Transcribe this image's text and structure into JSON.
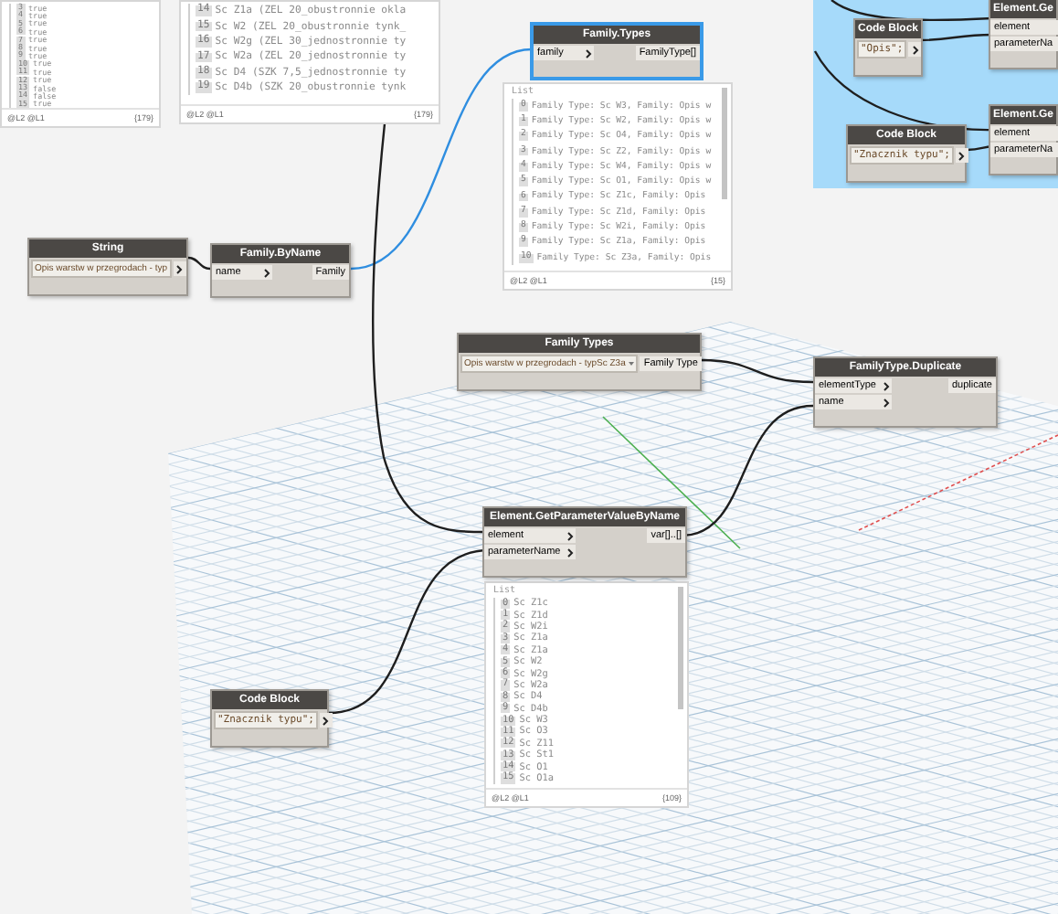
{
  "nodes": [
    {
      "kind": "string",
      "title": "String",
      "value": "Opis warstw w przegrodach - typ",
      "selected": false
    },
    {
      "kind": "function",
      "title": "Family.ByName",
      "inputs": [
        "name"
      ],
      "outputs": [
        "Family"
      ],
      "selected": false
    },
    {
      "kind": "function",
      "title": "Family.Types",
      "inputs": [
        "family"
      ],
      "outputs": [
        "FamilyType[]"
      ],
      "selected": true
    },
    {
      "kind": "dropdown",
      "title": "Family Types",
      "value": "Opis warstw w przegrodach - typSc Z3a",
      "outputs": [
        "Family Type"
      ],
      "selected": false
    },
    {
      "kind": "function",
      "title": "FamilyType.Duplicate",
      "inputs": [
        "elementType",
        "name"
      ],
      "outputs": [
        "duplicate"
      ],
      "selected": false
    },
    {
      "kind": "function",
      "title": "Element.GetParameterValueByName",
      "inputs": [
        "element",
        "parameterName"
      ],
      "outputs": [
        "var[]..[]"
      ],
      "selected": false
    },
    {
      "kind": "code",
      "title": "Code Block",
      "value": "\"Znacznik typu\";",
      "selected": false
    },
    {
      "kind": "code",
      "title": "Code Block",
      "value": "\"Opis\";",
      "selected": false
    },
    {
      "kind": "function",
      "title": "Element.Ge",
      "inputs": [
        "element",
        "parameterNa"
      ],
      "selected": false
    },
    {
      "kind": "code",
      "title": "Code Block",
      "value": "\"Znacznik typu\";",
      "selected": false
    },
    {
      "kind": "function",
      "title": "Element.Ge",
      "inputs": [
        "element",
        "parameterNa"
      ],
      "selected": false
    }
  ],
  "previews": [
    {
      "items": [
        {
          "index": "3",
          "value": "true"
        },
        {
          "index": "4",
          "value": "true"
        },
        {
          "index": "5",
          "value": "true"
        },
        {
          "index": "6",
          "value": "true"
        },
        {
          "index": "7",
          "value": "true"
        },
        {
          "index": "8",
          "value": "true"
        },
        {
          "index": "9",
          "value": "true"
        },
        {
          "index": "10",
          "value": "true"
        },
        {
          "index": "11",
          "value": "true"
        },
        {
          "index": "12",
          "value": "true"
        },
        {
          "index": "13",
          "value": "false"
        },
        {
          "index": "14",
          "value": "false"
        },
        {
          "index": "15",
          "value": "true"
        }
      ],
      "levels": "@L2 @L1",
      "count": "{179}"
    },
    {
      "items": [
        {
          "index": "14",
          "value": "Sc Z1a (ZEL 20_obustronnie okla"
        },
        {
          "index": "15",
          "value": "Sc W2 (ZEL 20_obustronnie tynk_"
        },
        {
          "index": "16",
          "value": "Sc W2g (ZEL 30_jednostronnie ty"
        },
        {
          "index": "17",
          "value": "Sc W2a (ZEL 20_jednostronnie ty"
        },
        {
          "index": "18",
          "value": "Sc D4 (SZK 7,5_jednostronnie ty"
        },
        {
          "index": "19",
          "value": "Sc D4b (SZK 20_obustronnie tynk"
        }
      ],
      "levels": "@L2 @L1",
      "count": "{179}"
    },
    {
      "header": "List",
      "items": [
        {
          "index": "0",
          "value": "Family Type: Sc W3, Family: Opis w"
        },
        {
          "index": "1",
          "value": "Family Type: Sc W2, Family: Opis w"
        },
        {
          "index": "2",
          "value": "Family Type: Sc O4, Family: Opis w"
        },
        {
          "index": "3",
          "value": "Family Type: Sc Z2, Family: Opis w"
        },
        {
          "index": "4",
          "value": "Family Type: Sc W4, Family: Opis w"
        },
        {
          "index": "5",
          "value": "Family Type: Sc O1, Family: Opis w"
        },
        {
          "index": "6",
          "value": "Family Type: Sc Z1c, Family: Opis"
        },
        {
          "index": "7",
          "value": "Family Type: Sc Z1d, Family: Opis"
        },
        {
          "index": "8",
          "value": "Family Type: Sc W2i, Family: Opis"
        },
        {
          "index": "9",
          "value": "Family Type: Sc Z1a, Family: Opis"
        },
        {
          "index": "10",
          "value": "Family Type: Sc Z3a, Family: Opis"
        }
      ],
      "levels": "@L2 @L1",
      "count": "{15}"
    },
    {
      "header": "List",
      "items": [
        {
          "index": "0",
          "value": "Sc Z1c"
        },
        {
          "index": "1",
          "value": "Sc Z1d"
        },
        {
          "index": "2",
          "value": "Sc W2i"
        },
        {
          "index": "3",
          "value": "Sc Z1a"
        },
        {
          "index": "4",
          "value": "Sc Z1a"
        },
        {
          "index": "5",
          "value": "Sc W2"
        },
        {
          "index": "6",
          "value": "Sc W2g"
        },
        {
          "index": "7",
          "value": "Sc W2a"
        },
        {
          "index": "8",
          "value": "Sc D4"
        },
        {
          "index": "9",
          "value": "Sc D4b"
        },
        {
          "index": "10",
          "value": "Sc W3"
        },
        {
          "index": "11",
          "value": "Sc O3"
        },
        {
          "index": "12",
          "value": "Sc Z11"
        },
        {
          "index": "13",
          "value": "Sc St1"
        },
        {
          "index": "14",
          "value": "Sc O1"
        },
        {
          "index": "15",
          "value": "Sc O1a"
        }
      ],
      "levels": "@L2 @L1",
      "count": "{109}"
    }
  ]
}
